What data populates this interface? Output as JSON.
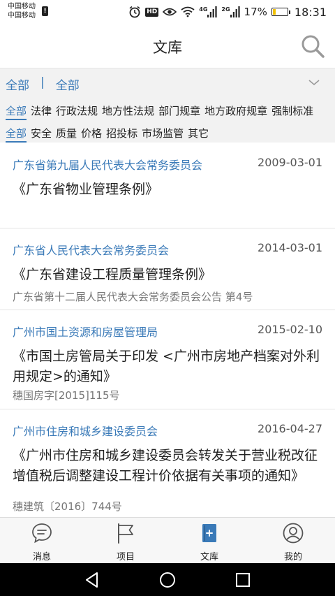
{
  "status_bar": {
    "carrier_1": "中国移动",
    "carrier_2": "中国移动",
    "network_1": "4G",
    "network_2": "2G",
    "battery": "17%",
    "battery_level": 0.17,
    "time": "18:31",
    "hd_label": "HD"
  },
  "header": {
    "title": "文库"
  },
  "filters": {
    "crumb_1": "全部",
    "separator": "|",
    "crumb_2": "全部",
    "row1": [
      "全部",
      "法律",
      "行政法规",
      "地方性法规",
      "部门规章",
      "地方政府规章",
      "强制标准"
    ],
    "row2": [
      "全部",
      "安全",
      "质量",
      "价格",
      "招投标",
      "市场监管",
      "其它"
    ]
  },
  "documents": [
    {
      "issuer": "广东省第九届人民代表大会常务委员会",
      "date": "2009-03-01",
      "title": "《广东省物业管理条例》",
      "doc_no": ""
    },
    {
      "issuer": "广东省人民代表大会常务委员会",
      "date": "2014-03-01",
      "title": "《广东省建设工程质量管理条例》",
      "doc_no": "广东省第十二届人民代表大会常务委员会公告 第4号"
    },
    {
      "issuer": "广州市国土资源和房屋管理局",
      "date": "2015-02-10",
      "title": "《市国土房管局关于印发 <广州市房地产档案对外利用规定>的通知》",
      "doc_no": "穗国房字[2015]115号"
    },
    {
      "issuer": "广州市住房和城乡建设委员会",
      "date": "2016-04-27",
      "title": "《广州市住房和城乡建设委员会转发关于营业税改征增值税后调整建设工程计价依据有关事项的通知》",
      "doc_no": "穗建筑〔2016〕744号"
    }
  ],
  "bottom_nav": {
    "messages": "消息",
    "projects": "项目",
    "library": "文库",
    "mine": "我的"
  },
  "colors": {
    "accent": "#3a7ab8",
    "filter_bg": "#f2f2f2"
  }
}
